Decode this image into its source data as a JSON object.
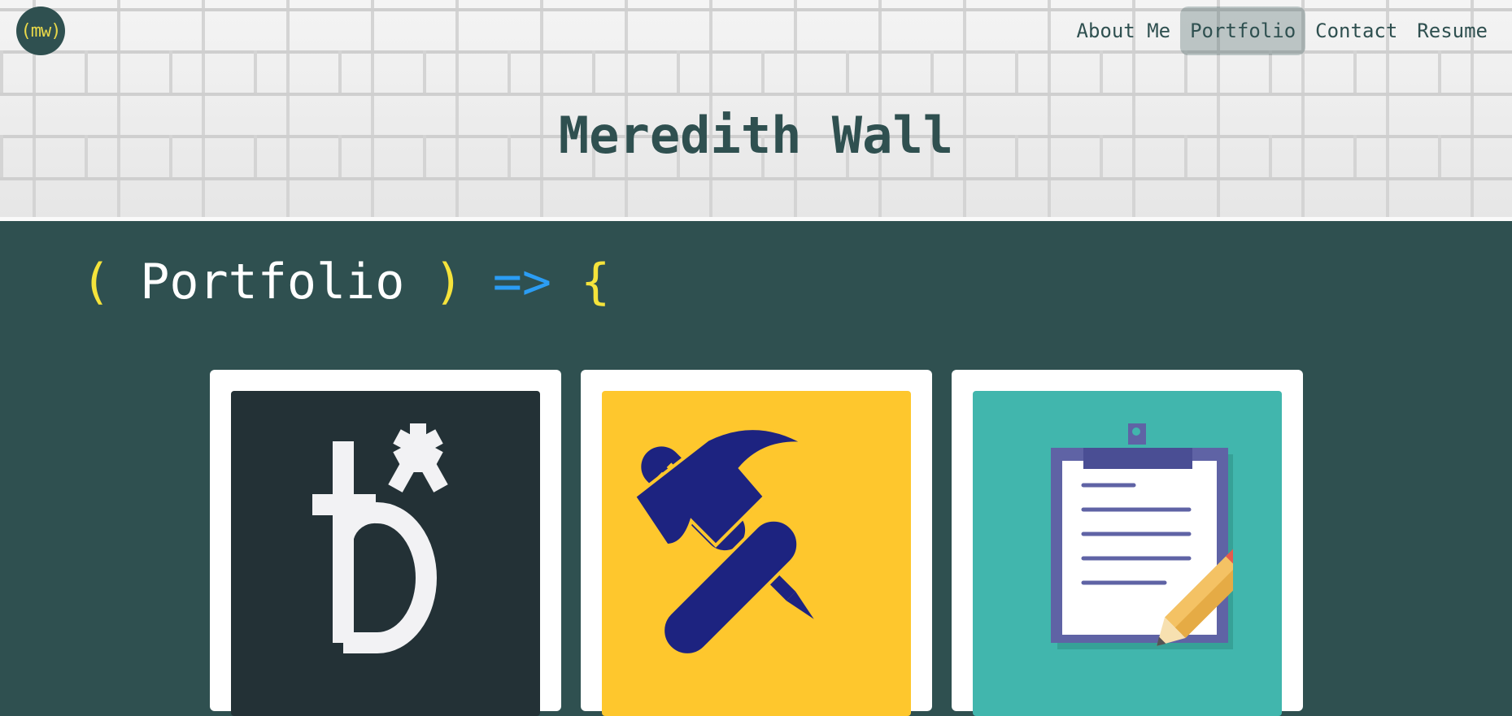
{
  "logo": {
    "text": "(mw)"
  },
  "nav": {
    "items": [
      {
        "label": "About Me",
        "active": false
      },
      {
        "label": "Portfolio",
        "active": true
      },
      {
        "label": "Contact",
        "active": false
      },
      {
        "label": "Resume",
        "active": false
      }
    ]
  },
  "header": {
    "title": "Meredith Wall"
  },
  "portfolio": {
    "heading": {
      "open_paren": "(",
      "word": "Portfolio",
      "close_paren": ")",
      "arrow": "=>",
      "brace": "{"
    },
    "cards": [
      {
        "icon": "letter-b-asterisk-icon",
        "bg": "#233136"
      },
      {
        "icon": "hammer-screwdriver-icon",
        "bg": "#fec72d"
      },
      {
        "icon": "clipboard-pencil-icon",
        "bg": "#41b6ad"
      }
    ]
  },
  "colors": {
    "primary": "#2f5050",
    "yellow": "#f5e33b",
    "blue": "#2b9df4",
    "icon_navy": "#1d2380",
    "clipboard_purple": "#5f63a5"
  }
}
